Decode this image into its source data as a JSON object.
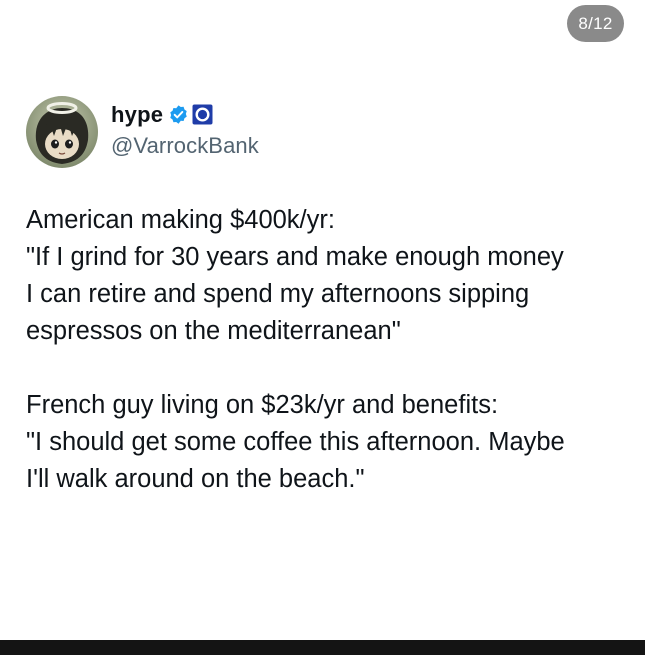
{
  "viewer": {
    "page_counter": "8/12"
  },
  "tweet": {
    "author": {
      "display_name": "hype",
      "handle": "@VarrockBank",
      "avatar_icon": "anime-character-avatar",
      "verified_icon": "verified-badge-icon",
      "affiliate_icon": "affiliate-badge-icon"
    },
    "paragraphs": [
      {
        "lines": [
          "American making $400k/yr:",
          "\"If I grind for 30 years and make enough money",
          "I can retire and spend my afternoons sipping",
          "espressos on the mediterranean\""
        ]
      },
      {
        "lines": [
          "French guy living on $23k/yr and benefits:",
          "\"I should get some coffee this afternoon. Maybe",
          "I'll walk around on the beach.\""
        ]
      }
    ]
  },
  "colors": {
    "verified_blue": "#1d9bf0",
    "text_primary": "#0f1419",
    "text_secondary": "#536471",
    "counter_bg": "#8a8a8a"
  }
}
